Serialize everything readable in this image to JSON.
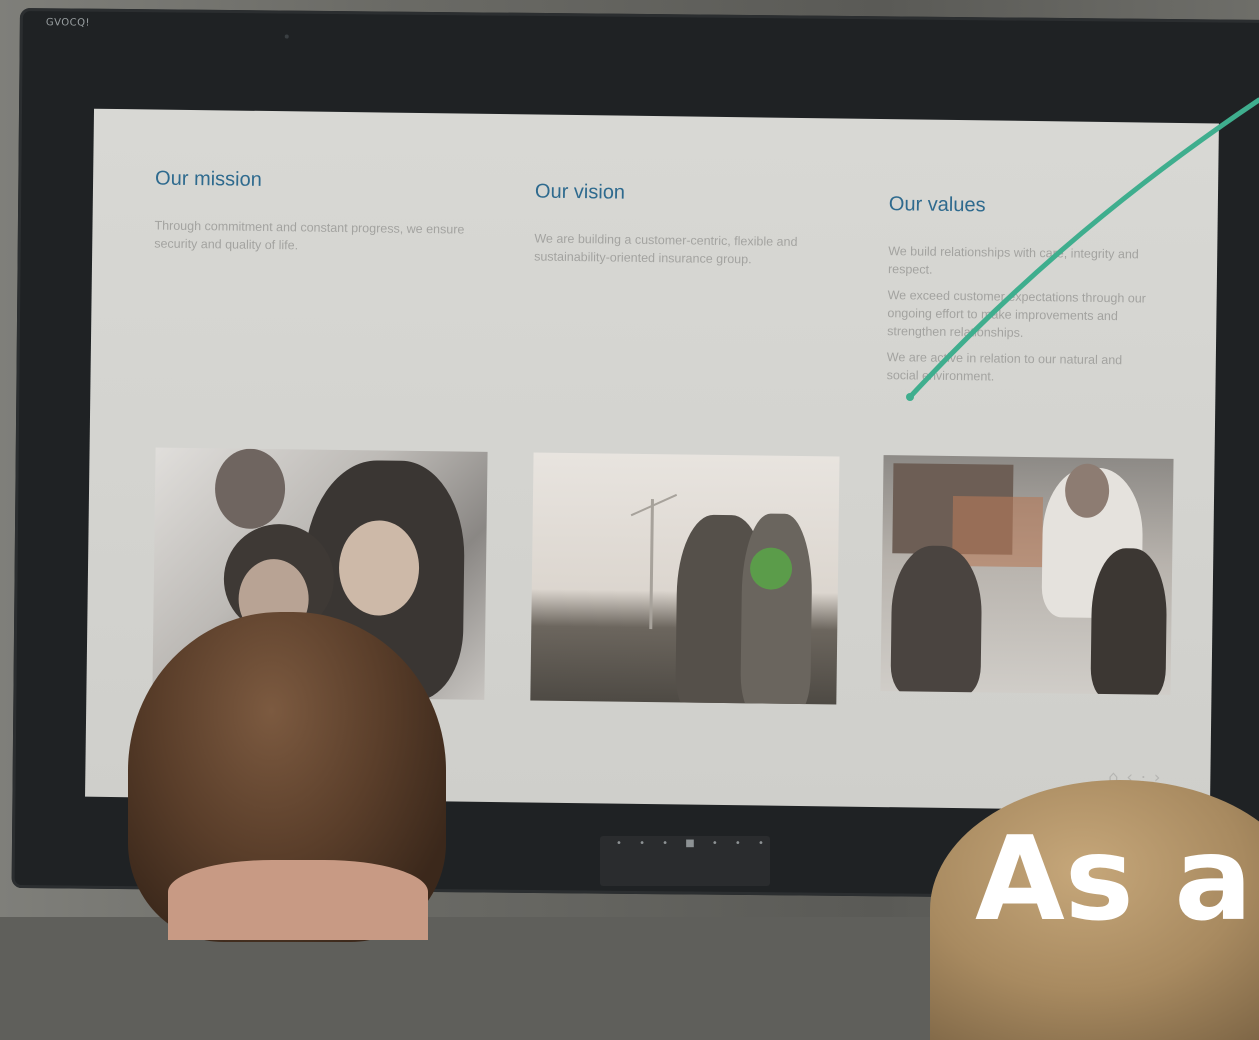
{
  "monitor": {
    "brand": "GVOCQ!"
  },
  "slide": {
    "mission": {
      "heading": "Our mission",
      "text": "Through commitment and constant progress, we ensure security and quality of life."
    },
    "vision": {
      "heading": "Our vision",
      "text": "We are building a customer-centric, flexible and sustainability-oriented insurance group."
    },
    "values": {
      "heading": "Our values",
      "items": [
        "We build relationships with care, integrity and respect.",
        "We exceed customer expectations through our ongoing effort to make improvements and strengthen relationships.",
        "We are active in relation to our natural and social environment."
      ]
    },
    "nav_icons": [
      "home-icon",
      "prev-icon",
      "next-icon"
    ]
  },
  "overlay": {
    "text": "As a",
    "accent_color": "#3fae8e"
  }
}
